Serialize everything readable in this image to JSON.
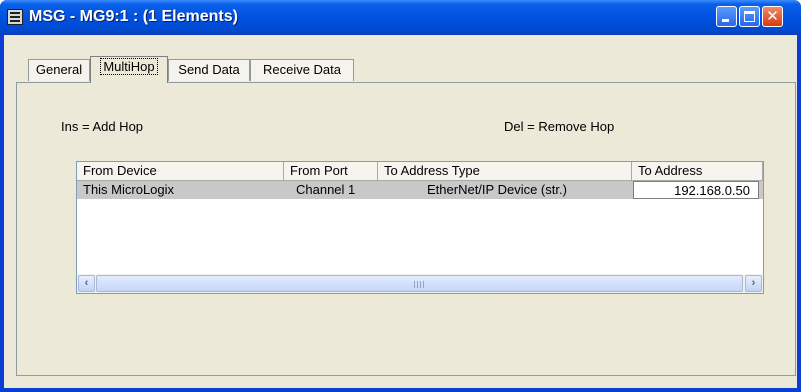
{
  "window": {
    "title": "MSG - MG9:1 : (1 Elements)",
    "title_color": "#ffffff",
    "titlebar_color": "#0052e0",
    "buttons": {
      "minimize_icon": "minimize-icon",
      "maximize_icon": "maximize-icon",
      "close_icon": "close-icon",
      "close_glyph": "✕"
    }
  },
  "tabs": [
    {
      "label": "General",
      "active": false
    },
    {
      "label": "MultiHop",
      "active": true
    },
    {
      "label": "Send Data",
      "active": false
    },
    {
      "label": "Receive Data",
      "active": false
    }
  ],
  "hints": {
    "insert": "Ins = Add Hop",
    "delete": "Del = Remove Hop"
  },
  "table": {
    "columns": [
      "From Device",
      "From Port",
      "To Address Type",
      "To Address"
    ],
    "rows": [
      {
        "from_device": "This MicroLogix",
        "from_port": "Channel  1",
        "to_address_type": "EtherNet/IP Device (str.)",
        "to_address": "192.168.0.50"
      }
    ],
    "row_highlight_color": "#c8c8c8"
  },
  "scrollbar": {
    "left_arrow": "‹",
    "right_arrow": "›"
  }
}
